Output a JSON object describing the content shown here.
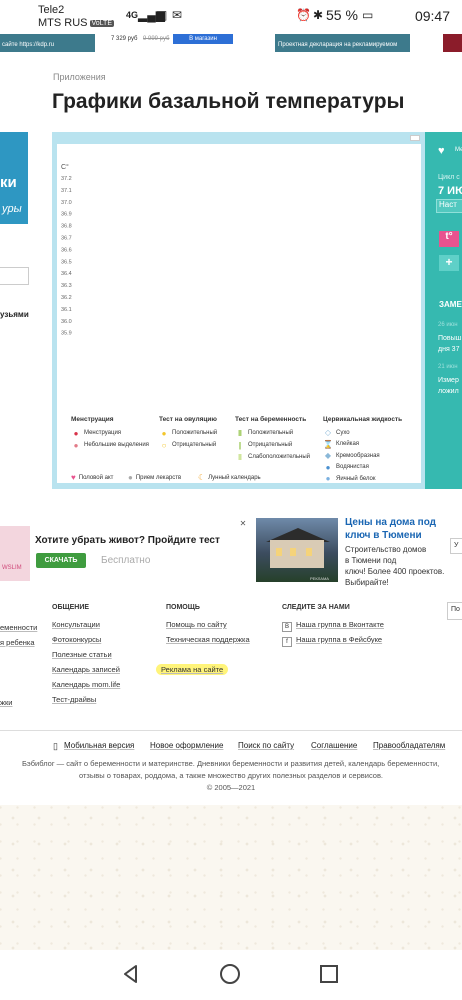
{
  "status_bar": {
    "carrier1": "Tele2",
    "carrier2": "MTS RUS",
    "volte": "VoLTE",
    "net": "4G",
    "battery": "55 %",
    "time": "09:47"
  },
  "top_ads": {
    "left_text": "сайте https://kdp.ru",
    "price": "7 329 руб",
    "old_price": "9 999 руб",
    "shop_button": "В магазин",
    "right_text": "Проектная декларация на рекламируемом"
  },
  "breadcrumb": "Приложения",
  "page_title": "Графики базальной температуры",
  "left_banner": {
    "text1": "ки",
    "text2": "уры",
    "friends": "узьями"
  },
  "chart_data": {
    "type": "line",
    "ylabel": "С°",
    "y_ticks": [
      "37.2",
      "37.1",
      "37.0",
      "36.9",
      "36.8",
      "36.7",
      "36.6",
      "36.5",
      "36.4",
      "36.3",
      "36.2",
      "36.1",
      "36.0",
      "35.9"
    ],
    "ylim": [
      35.9,
      37.2
    ],
    "series": []
  },
  "legend": {
    "menstruation": {
      "title": "Менструация",
      "items": [
        "Менструация",
        "Небольшие выделения"
      ]
    },
    "ovulation": {
      "title": "Тест на овуляцию",
      "items": [
        "Положительный",
        "Отрицательный"
      ]
    },
    "pregnancy": {
      "title": "Тест на беременность",
      "items": [
        "Положительный",
        "Отрицательный",
        "Слабоположительный"
      ]
    },
    "fluid": {
      "title": "Цервикальная жидкость",
      "items": [
        "Сухо",
        "Клейкая",
        "Кремообразная",
        "Водянистая",
        "Яичный белок"
      ]
    },
    "bottom": [
      "Половой акт",
      "Прием лекарств",
      "Лунный календарь"
    ]
  },
  "sidebar": {
    "me": "Ме",
    "cycle": "Цикл с",
    "date": "7 ИЮ",
    "settings": "Наст",
    "notes_title": "ЗАМЕТ",
    "note1_date": "26 июн",
    "note1_text": [
      "Повыш",
      "дня 37"
    ],
    "note2_date": "21 июн",
    "note2_text": [
      "Измер",
      "ложил"
    ]
  },
  "ad1": {
    "slim": "WSLIM",
    "title": "Хотите убрать живот? Пройдите тест",
    "download": "СКАЧАТЬ",
    "free": "Бесплатно"
  },
  "ad2": {
    "title": [
      "Цены на дома под",
      "ключ в Тюмени"
    ],
    "desc": [
      "Строительство домов",
      "в Тюмени под",
      "ключ! Более 400 проектов.",
      "Выбирайте!"
    ],
    "label": "РЕКЛАМА",
    "button": "У"
  },
  "footer": {
    "left": [
      "еменности",
      "я ребенка",
      "",
      "",
      "",
      "",
      "жки"
    ],
    "general": {
      "title": "ОБЩЕНИЕ",
      "links": [
        "Консультации",
        "Фотоконкурсы",
        "Полезные статьи",
        "Календарь записей",
        "Календарь mom.life",
        "Тест-драйвы"
      ]
    },
    "help": {
      "title": "ПОМОЩЬ",
      "links": [
        "Помощь по сайту",
        "Техническая поддержка",
        "",
        "Реклама на сайте"
      ]
    },
    "follow": {
      "title": "СЛЕДИТЕ ЗА НАМИ",
      "links": [
        "Наша группа в Вконтакте",
        "Наша группа в Фейсбуке"
      ]
    },
    "right_box": "По"
  },
  "bottom_nav": [
    "Мобильная версия",
    "Новое оформление",
    "Поиск по сайту",
    "Соглашение",
    "Правообладателям"
  ],
  "description": [
    "Бэбиблог — сайт о беременности и материнстве. Дневники беременности и развития детей, календарь беременности,",
    "отзывы о товарах, роддома, а также множество других полезных разделов и сервисов.",
    "© 2005—2021"
  ],
  "colors": {
    "teal": "#36b9b0",
    "frame": "#b9e3ef",
    "highlight": "#fff47a",
    "download": "#3f9c3f",
    "ad_link": "#1a66b3"
  }
}
